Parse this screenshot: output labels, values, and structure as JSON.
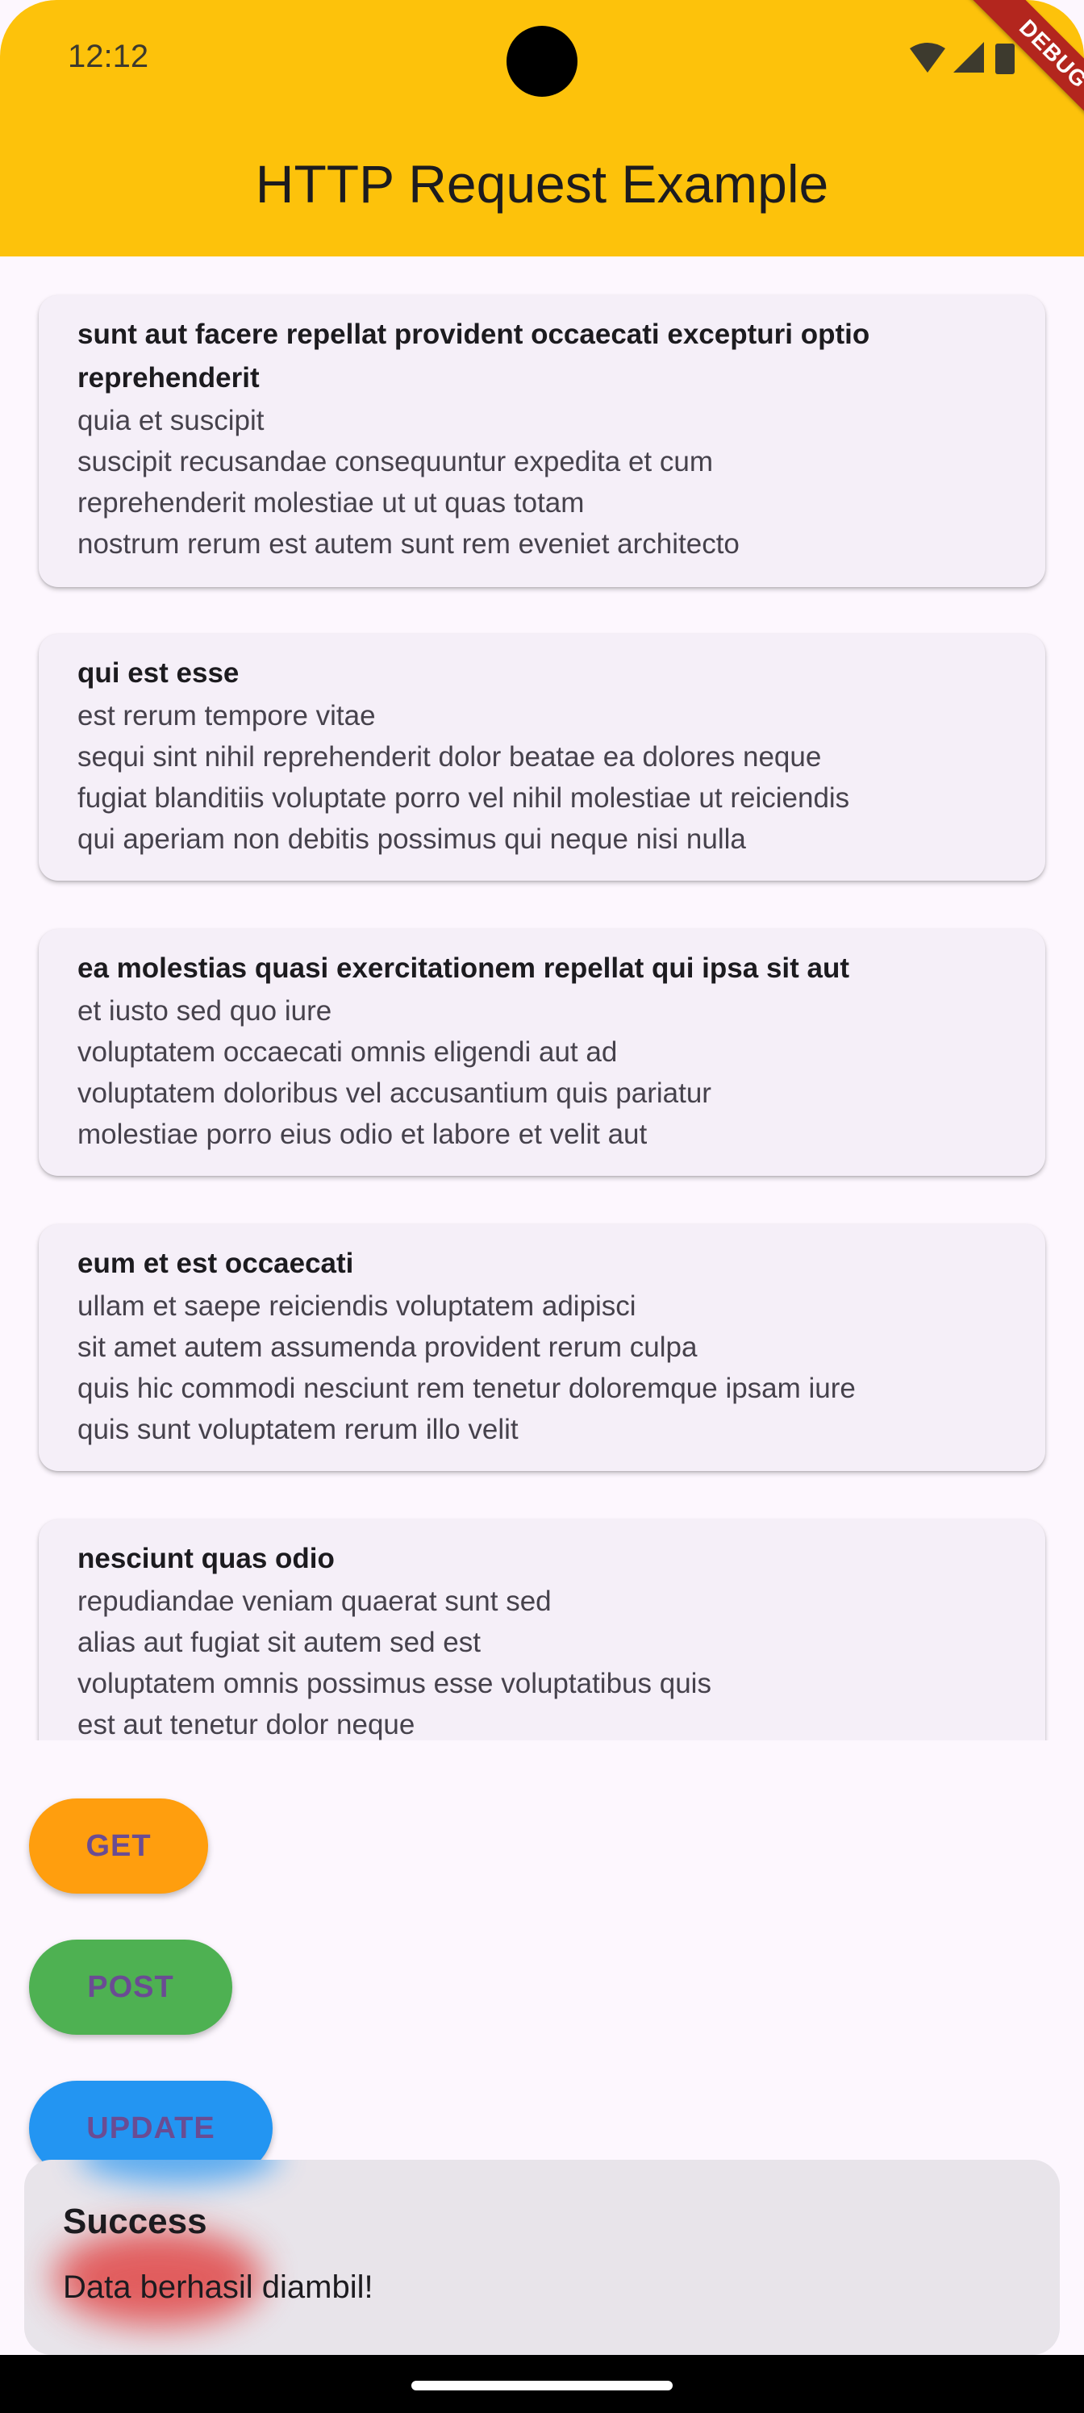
{
  "status_bar": {
    "time": "12:12",
    "icons": [
      "wifi-icon",
      "signal-icon",
      "battery-icon"
    ]
  },
  "app_bar": {
    "title": "HTTP Request Example",
    "debug_banner": "DEBUG",
    "color": "#fdc20b"
  },
  "posts": [
    {
      "title": "sunt aut facere repellat provident occaecati excepturi optio reprehenderit",
      "body": "quia et suscipit\nsuscipit recusandae consequuntur expedita et cum\nreprehenderit molestiae ut ut quas totam\nnostrum rerum est autem sunt rem eveniet architecto"
    },
    {
      "title": "qui est esse",
      "body": "est rerum tempore vitae\nsequi sint nihil reprehenderit dolor beatae ea dolores neque\nfugiat blanditiis voluptate porro vel nihil molestiae ut reiciendis\nqui aperiam non debitis possimus qui neque nisi nulla"
    },
    {
      "title": "ea molestias quasi exercitationem repellat qui ipsa sit aut",
      "body": "et iusto sed quo iure\nvoluptatem occaecati omnis eligendi aut ad\nvoluptatem doloribus vel accusantium quis pariatur\nmolestiae porro eius odio et labore et velit aut"
    },
    {
      "title": "eum et est occaecati",
      "body": "ullam et saepe reiciendis voluptatem adipisci\nsit amet autem assumenda provident rerum culpa\nquis hic commodi nesciunt rem tenetur doloremque ipsam iure\nquis sunt voluptatem rerum illo velit"
    },
    {
      "title": "nesciunt quas odio",
      "body": "repudiandae veniam quaerat sunt sed\nalias aut fugiat sit autem sed est\nvoluptatem omnis possimus esse voluptatibus quis\nest aut tenetur dolor neque"
    }
  ],
  "buttons": {
    "get": {
      "label": "GET",
      "color": "#ff9e0e"
    },
    "post": {
      "label": "POST",
      "color": "#4eb152"
    },
    "update": {
      "label": "UPDATE",
      "color": "#2395f2"
    }
  },
  "snackbar": {
    "title": "Success",
    "message": "Data berhasil diambil!"
  }
}
